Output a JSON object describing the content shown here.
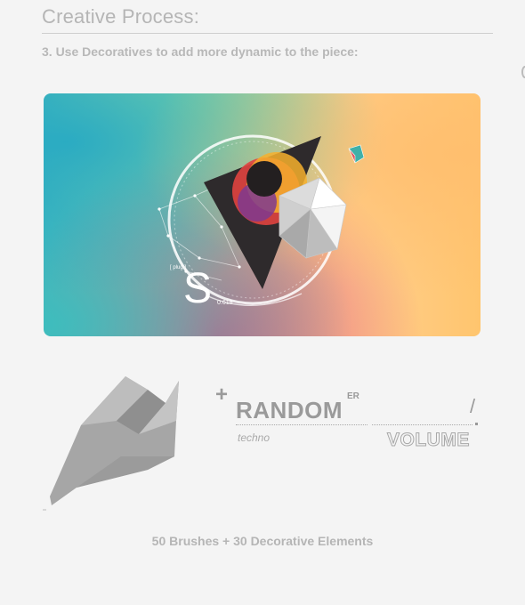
{
  "page": {
    "title": "Creative Process:",
    "subtitle": "3. Use Decoratives to add more dynamic to the piece:"
  },
  "hero": {
    "initial": "S",
    "caption_small_1": "[ plug ]",
    "caption_small_2": "0.618"
  },
  "decoratives": {
    "plus": "+",
    "word": "RANDOM",
    "superscript": "ER",
    "slash": "/",
    "tag": "techno",
    "word2": "VOLUME"
  },
  "footer": {
    "text": "50 Brushes + 30 Decorative Elements"
  },
  "colors": {
    "background": "#f4f4f4",
    "heading_gray": "#b5b5b5",
    "accent_teal": "#45b7bd",
    "accent_orange": "#ffc56e",
    "accent_pink": "#e14678"
  }
}
